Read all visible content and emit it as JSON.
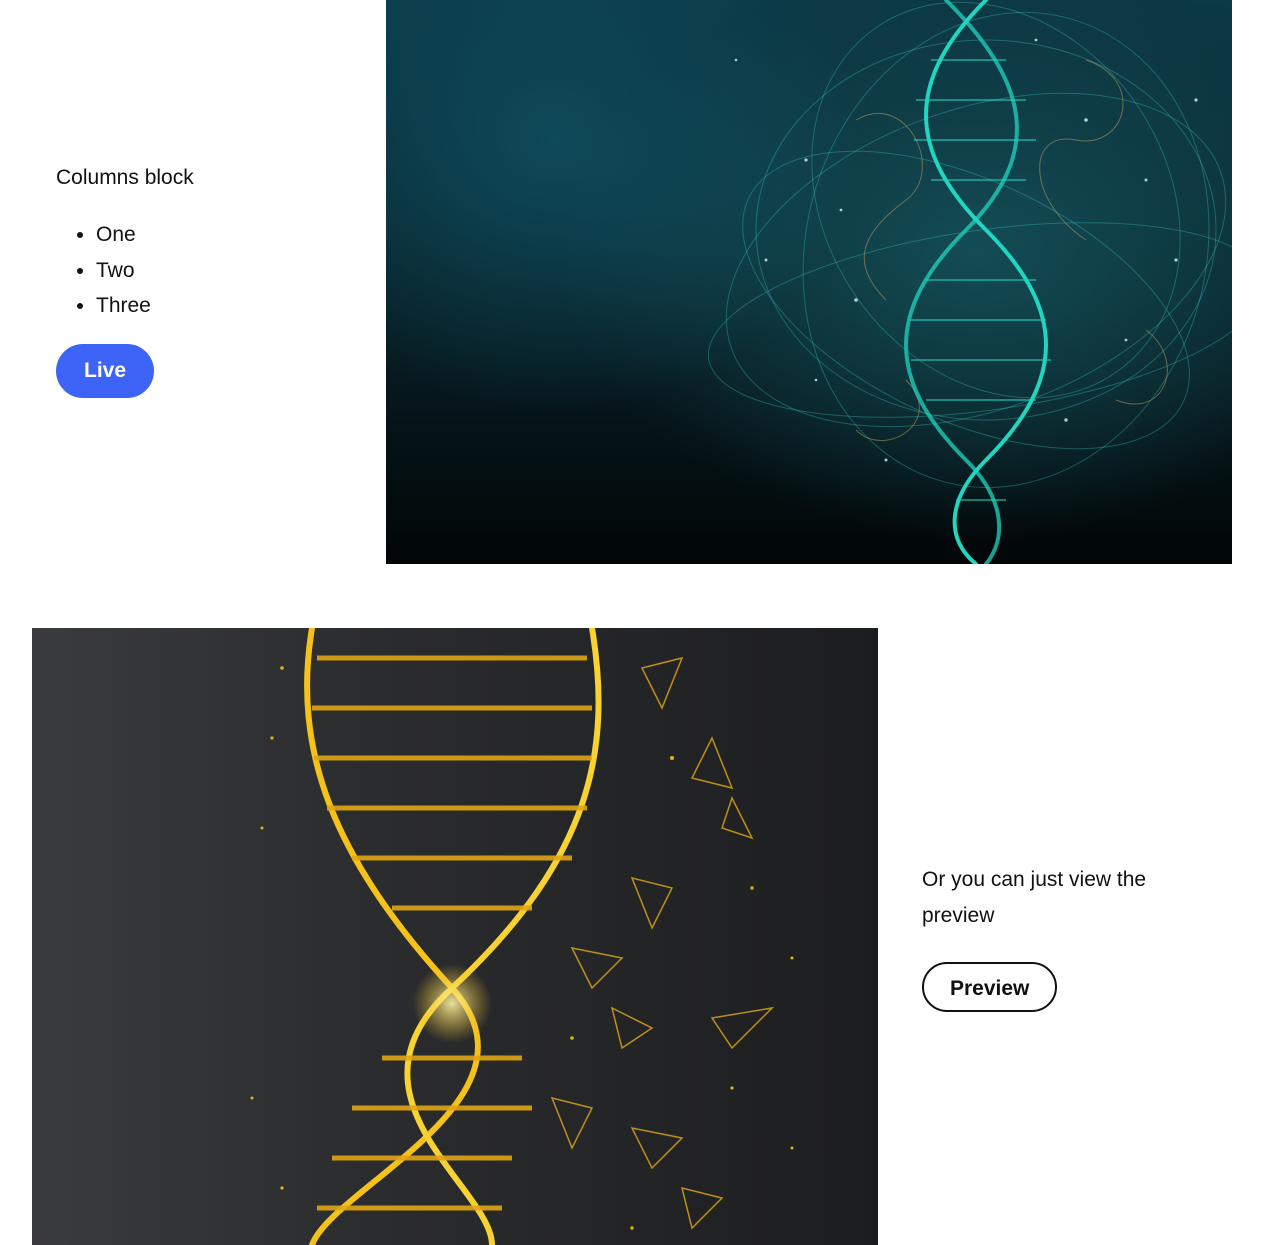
{
  "columns_block": {
    "title": "Columns block",
    "items": [
      "One",
      "Two",
      "Three"
    ],
    "live_button": "Live"
  },
  "preview_block": {
    "text": "Or you can just view the preview",
    "preview_button": "Preview"
  },
  "colors": {
    "primary_button": "#3d63f7",
    "teal_helix": "#1fd6c0",
    "gold_helix": "#f5c21a"
  }
}
